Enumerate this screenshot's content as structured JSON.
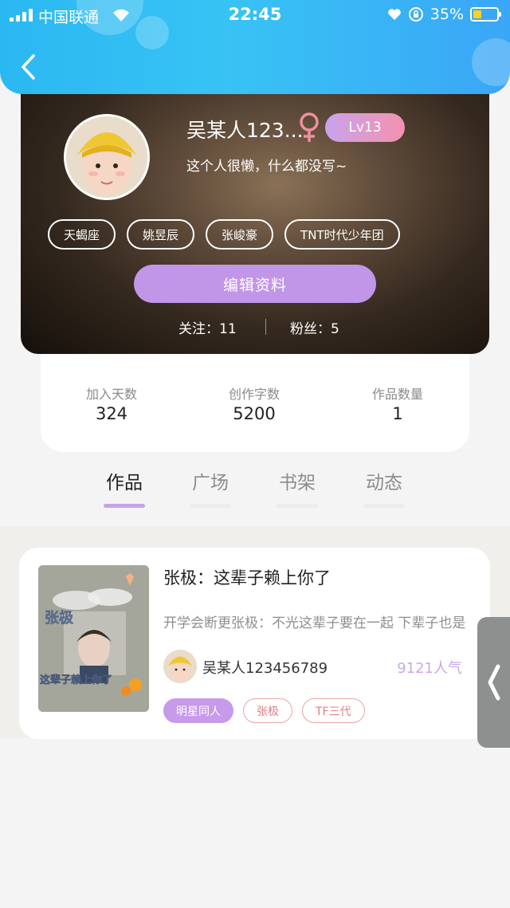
{
  "status_bar": {
    "carrier": "中国联通",
    "time": "22:45",
    "battery_percent": "35%",
    "icons": [
      "signal-icon",
      "wifi-icon",
      "heart-icon",
      "rotation-lock-icon",
      "battery-icon"
    ]
  },
  "header": {
    "back_icon": "chevron-left-icon",
    "accent_color": "#36bdf4"
  },
  "profile": {
    "nickname": "吴某人123...",
    "gender_icon": "female-icon",
    "level": "Lv13",
    "signature": "这个人很懒，什么都没写~",
    "tags": [
      "天蝎座",
      "姚昱辰",
      "张峻豪",
      "TNT时代少年团"
    ],
    "edit_label": "编辑资料",
    "following_label": "关注：11",
    "followers_label": "粉丝：5"
  },
  "stats": [
    {
      "label": "加入天数",
      "value": "324"
    },
    {
      "label": "创作字数",
      "value": "5200"
    },
    {
      "label": "作品数量",
      "value": "1"
    }
  ],
  "tabs": [
    {
      "label": "作品",
      "active": true
    },
    {
      "label": "广场",
      "active": false
    },
    {
      "label": "书架",
      "active": false
    },
    {
      "label": "动态",
      "active": false
    }
  ],
  "work": {
    "title": "张极：这辈子赖上你了",
    "description": "开学会断更张极：不光这辈子要在一起 下辈子也是",
    "author": "吴某人123456789",
    "popularity": "9121人气",
    "tags": [
      {
        "label": "明星同人",
        "style": "filled"
      },
      {
        "label": "张极",
        "style": "outline"
      },
      {
        "label": "TF三代",
        "style": "outline"
      }
    ],
    "cover": {
      "text_top": "张极",
      "text_bottom": "这辈子赖上你了"
    }
  },
  "side_handle": {
    "icon": "chevron-left-icon"
  },
  "colors": {
    "purple": "#c196e8",
    "level_gradient_start": "#c8a3ec",
    "level_gradient_end": "#f591ae",
    "tag_outline": "#e8a4a6",
    "battery": "#ffd21e"
  }
}
